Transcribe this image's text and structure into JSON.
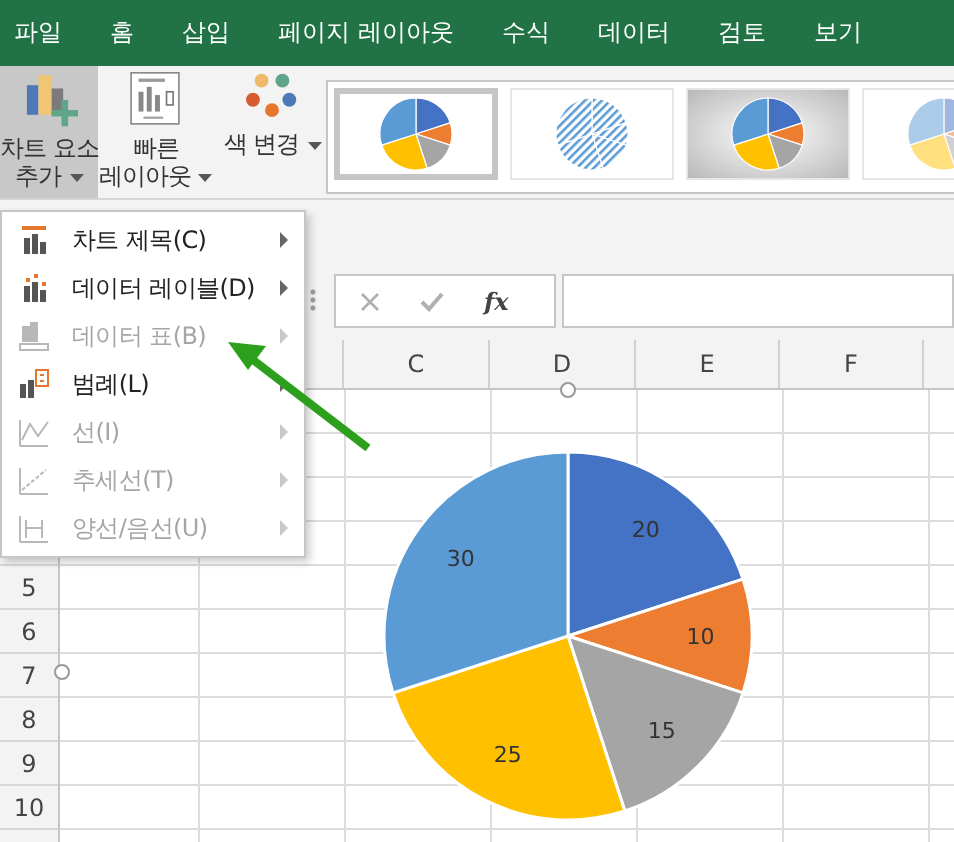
{
  "tabs": [
    {
      "label": "파일"
    },
    {
      "label": "홈"
    },
    {
      "label": "삽입"
    },
    {
      "label": "페이지 레이아웃"
    },
    {
      "label": "수식"
    },
    {
      "label": "데이터"
    },
    {
      "label": "검토"
    },
    {
      "label": "보기"
    }
  ],
  "ribbon": {
    "buttons": [
      {
        "kind": "add-element",
        "lines": [
          "차트 요소",
          "추가"
        ],
        "pressed": true
      },
      {
        "kind": "quick-layout",
        "lines": [
          "빠른",
          "레이아웃"
        ],
        "pressed": false
      },
      {
        "kind": "change-colors",
        "lines": [
          "색 변경"
        ],
        "pressed": false
      }
    ],
    "chart_styles": [
      {
        "kind": "plain",
        "selected": true
      },
      {
        "kind": "hatched",
        "selected": false
      },
      {
        "kind": "shaded",
        "selected": false
      },
      {
        "kind": "light",
        "selected": false
      }
    ]
  },
  "formula_bar": {
    "function_label": "fx"
  },
  "menu": {
    "items": [
      {
        "label": "차트 제목(C)",
        "disabled": false
      },
      {
        "label": "데이터 레이블(D)",
        "disabled": false
      },
      {
        "label": "데이터 표(B)",
        "disabled": true
      },
      {
        "label": "범례(L)",
        "disabled": false
      },
      {
        "label": "선(I)",
        "disabled": true
      },
      {
        "label": "추세선(T)",
        "disabled": true
      },
      {
        "label": "양선/음선(U)",
        "disabled": true
      }
    ]
  },
  "sheet": {
    "columns": [
      "C",
      "D",
      "E",
      "F"
    ],
    "rows": [
      "5",
      "6",
      "7",
      "8",
      "9",
      "10"
    ]
  },
  "chart": {
    "chart_data": {
      "type": "pie",
      "values": [
        20,
        10,
        15,
        25,
        30
      ],
      "data_labels": true,
      "colors": [
        "#4472c4",
        "#ed7d31",
        "#a5a5a5",
        "#ffc000",
        "#5b9bd5"
      ]
    }
  }
}
